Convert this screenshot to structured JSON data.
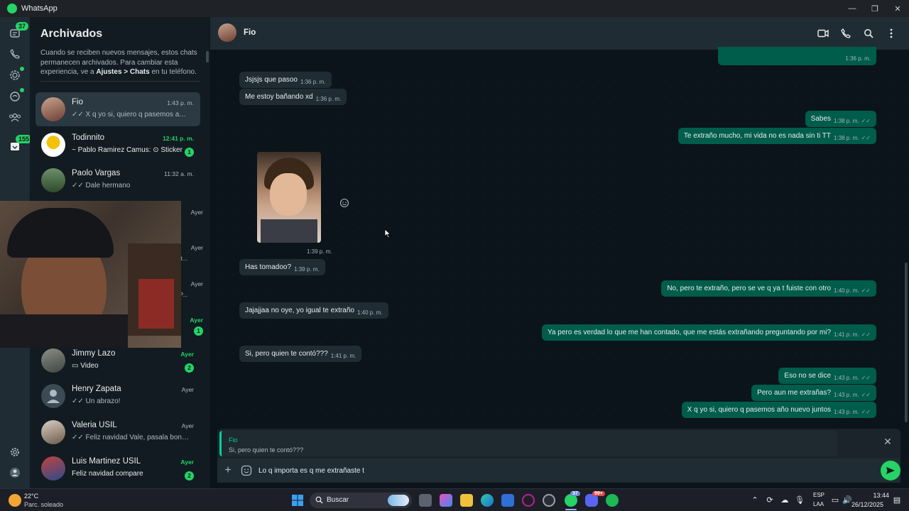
{
  "window": {
    "title": "WhatsApp"
  },
  "rail": {
    "chats_badge": "37",
    "archived_badge": "155"
  },
  "panel": {
    "title": "Archivados",
    "note_pre": "Cuando se reciben nuevos mensajes, estos chats permanecen archivados. Para cambiar esta experiencia, ve a ",
    "note_bold": "Ajustes > Chats",
    "note_post": " en tu teléfono."
  },
  "chats": [
    {
      "name": "Fio",
      "time": "1:43 p. m.",
      "preview": "✓✓ X q yo si, quiero q pasemos año nu..."
    },
    {
      "name": "Todinnito",
      "time": "12:41 p. m.",
      "preview": "~ Pablo Ramirez Camus: ⊙ Sticker",
      "unread": "1"
    },
    {
      "name": "Paolo Vargas",
      "time": "11:32 a. m.",
      "preview": "✓✓ Dale hermano"
    },
    {
      "name": "Jimmy Lazo",
      "time": "Ayer",
      "preview": "▭ Video",
      "unread": "2"
    },
    {
      "name": "Henry Zapata",
      "time": "Ayer",
      "preview": "✓✓ Un abrazo!"
    },
    {
      "name": "Valeria USIL",
      "time": "Ayer",
      "preview": "✓✓ Feliz navidad Vale, pasala bonito!"
    },
    {
      "name": "Luis Martinez USIL",
      "time": "Ayer",
      "preview": "Feliz navidad compare",
      "unread": "2"
    }
  ],
  "hidden_chats": {
    "t1": "Ayer",
    "t2": "Ayer",
    "t3": "Ayer",
    "t4": "Ayer",
    "frag2": "t...",
    "frag3": "P...",
    "badge4": "1"
  },
  "conversation": {
    "contact": "Fio",
    "messages": [
      {
        "dir": "out",
        "text": "",
        "time": "1:36 p. m."
      },
      {
        "dir": "in",
        "text": "Jsjsjs que pasoo",
        "time": "1:36 p. m."
      },
      {
        "dir": "in",
        "text": "Me estoy bañando xd",
        "time": "1:36 p. m."
      },
      {
        "dir": "out",
        "text": "Sabes",
        "time": "1:38 p. m."
      },
      {
        "dir": "out",
        "text": "Te extraño mucho, mi vida no es nada sin ti TT",
        "time": "1:38 p. m."
      },
      {
        "dir": "in",
        "text": "",
        "time": "1:39 p. m."
      },
      {
        "dir": "in",
        "text": "Has tomadoo?",
        "time": "1:39 p. m."
      },
      {
        "dir": "out",
        "text": "No, pero te extraño, pero se ve q ya t fuiste con otro",
        "time": "1:40 p. m."
      },
      {
        "dir": "in",
        "text": "Jajajjaa no oye, yo igual te extraño",
        "time": "1:40 p. m."
      },
      {
        "dir": "out",
        "text": "Ya pero es verdad lo que me han contado, que me estás extrañando preguntando por mi?",
        "time": "1:41 p. m."
      },
      {
        "dir": "in",
        "text": "Si, pero quien te contó???",
        "time": "1:41 p. m."
      },
      {
        "dir": "out",
        "text": "Eso no se dice",
        "time": "1:43 p. m."
      },
      {
        "dir": "out",
        "text": "Pero aun me extrañas?",
        "time": "1:43 p. m."
      },
      {
        "dir": "out",
        "text": "X q yo si, quiero q pasemos año nuevo juntos",
        "time": "1:43 p. m."
      }
    ],
    "reply": {
      "name": "Fio",
      "text": "Si, pero quien te contó???"
    },
    "composer": {
      "value": "Lo q importa es q me extrañaste t"
    }
  },
  "taskbar": {
    "temp": "22°C",
    "weather": "Parc. soleado",
    "search": "Buscar",
    "lang1": "ESP",
    "lang2": "LAA",
    "time": "13:44",
    "date": "26/12/2025",
    "badge_a": "37",
    "badge_b": "99+"
  },
  "colors": {
    "accent": "#25d366",
    "outgoing": "#005c4b",
    "incoming": "#202c33",
    "background": "#0b141a"
  }
}
